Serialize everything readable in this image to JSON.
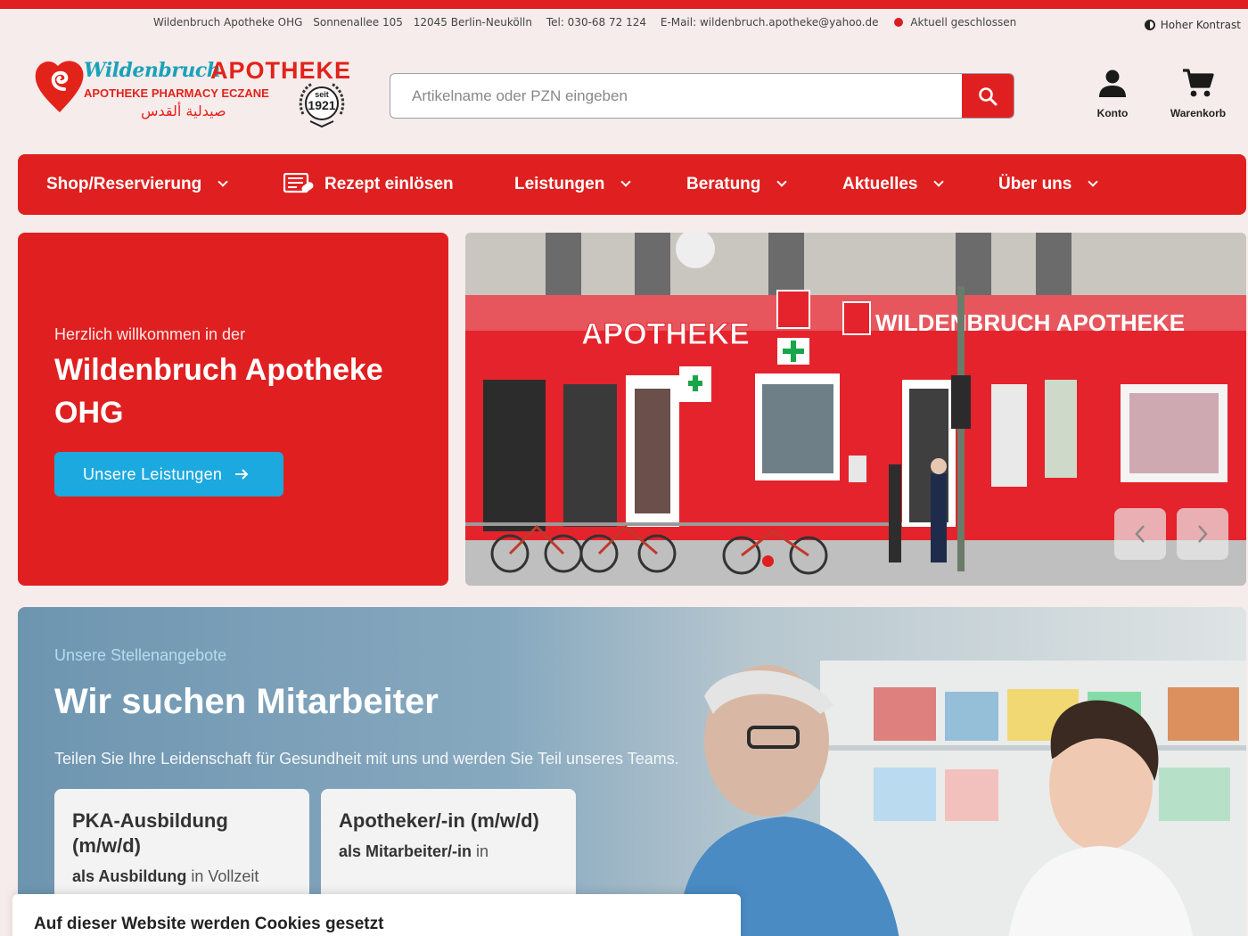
{
  "info_bar": {
    "company": "Wildenbruch Apotheke OHG",
    "street": "Sonnenallee 105",
    "city": "12045 Berlin-Neukölln",
    "phone": "Tel: 030-68 72 124",
    "email": "E-Mail: wildenbruch.apotheke@yahoo.de",
    "status": "Aktuell geschlossen",
    "status_color": "#d81e1e",
    "contrast_label": "Hoher Kontrast"
  },
  "logo": {
    "script": "Wildenbruch",
    "word": "APOTHEKE",
    "sub": "APOTHEKE PHARMACY ECZANE",
    "arabic": "صيدلية ألقدس",
    "seal_top": "seit",
    "seal_year": "1921"
  },
  "search": {
    "placeholder": "Artikelname oder PZN eingeben",
    "value": ""
  },
  "header_actions": {
    "account": "Konto",
    "cart": "Warenkorb"
  },
  "nav": {
    "items": [
      "Shop/Reservierung",
      "Rezept einlösen",
      "Leistungen",
      "Beratung",
      "Aktuelles",
      "Über uns"
    ]
  },
  "welcome": {
    "kicker": "Herzlich willkommen in der",
    "title": "Wildenbruch Apotheke OHG",
    "button": "Unsere Leistungen"
  },
  "hero": {
    "sign_left": "APOTHEKE",
    "sign_right": "WILDENBRUCH APOTHEKE"
  },
  "jobs": {
    "kicker": "Unsere Stellenangebote",
    "title": "Wir suchen Mitarbeiter",
    "text": "Teilen Sie Ihre Leidenschaft für Gesundheit mit uns und werden Sie Teil unseres Teams.",
    "cards": [
      {
        "title": "PKA-Ausbildung (m/w/d)",
        "type_bold": "als Ausbildung",
        "type_rest": " in Vollzeit"
      },
      {
        "title": "Apotheker/-in (m/w/d)",
        "type_bold": "als Mitarbeiter/-in",
        "type_rest": " in"
      }
    ]
  },
  "cookie": {
    "title": "Auf dieser Website werden Cookies gesetzt"
  },
  "colors": {
    "brand_red": "#e02020",
    "accent_blue": "#1ca9df",
    "logo_teal": "#1aa2b8",
    "page_bg": "#f6ecec"
  }
}
